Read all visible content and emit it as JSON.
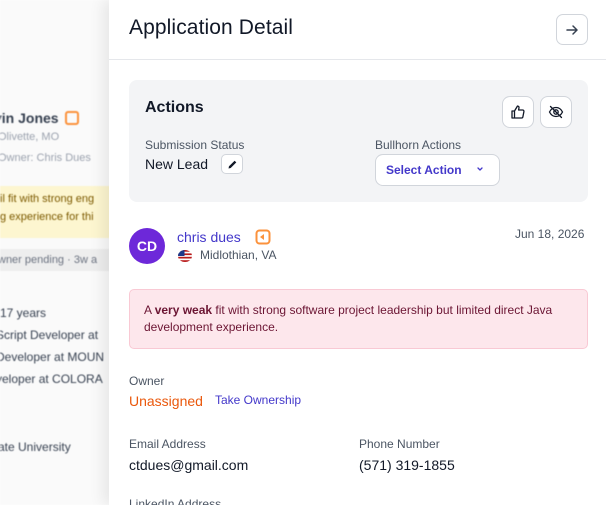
{
  "background": {
    "candidate_name": "vin Jones",
    "location": "Olivette, MO",
    "owner": "Owner: Chris Dues",
    "highlight_lines": [
      "il fit with strong eng",
      "g experience for thi"
    ],
    "pending": "wner pending · 3w a",
    "years": "17 years",
    "jobs": [
      "Script Developer at",
      "Developer at MOUN",
      "veloper at COLORA"
    ],
    "university": "ate University"
  },
  "panel": {
    "title": "Application Detail",
    "close_icon": "arrow-right-icon"
  },
  "actions": {
    "title": "Actions",
    "submission_status_label": "Submission Status",
    "submission_status_value": "New Lead",
    "bullhorn_label": "Bullhorn Actions",
    "select_action": "Select Action"
  },
  "candidate": {
    "initials": "CD",
    "name": "chris dues",
    "location": "Midlothian, VA",
    "date": "Jun 18, 2026"
  },
  "fit": {
    "prefix": "A ",
    "emphasis": "very weak",
    "text": " fit with strong software project leadership but limited direct Java development experience."
  },
  "owner": {
    "label": "Owner",
    "value": "Unassigned",
    "take_ownership": "Take Ownership"
  },
  "contact": {
    "email_label": "Email Address",
    "email": "ctdues@gmail.com",
    "phone_label": "Phone Number",
    "phone": "(571) 319-1855",
    "linkedin_label": "LinkedIn Address"
  },
  "colors": {
    "accent": "#4338ca",
    "avatar": "#6d28d9",
    "owner_unassigned": "#ea580c",
    "fit_bg": "#fde7ec"
  }
}
